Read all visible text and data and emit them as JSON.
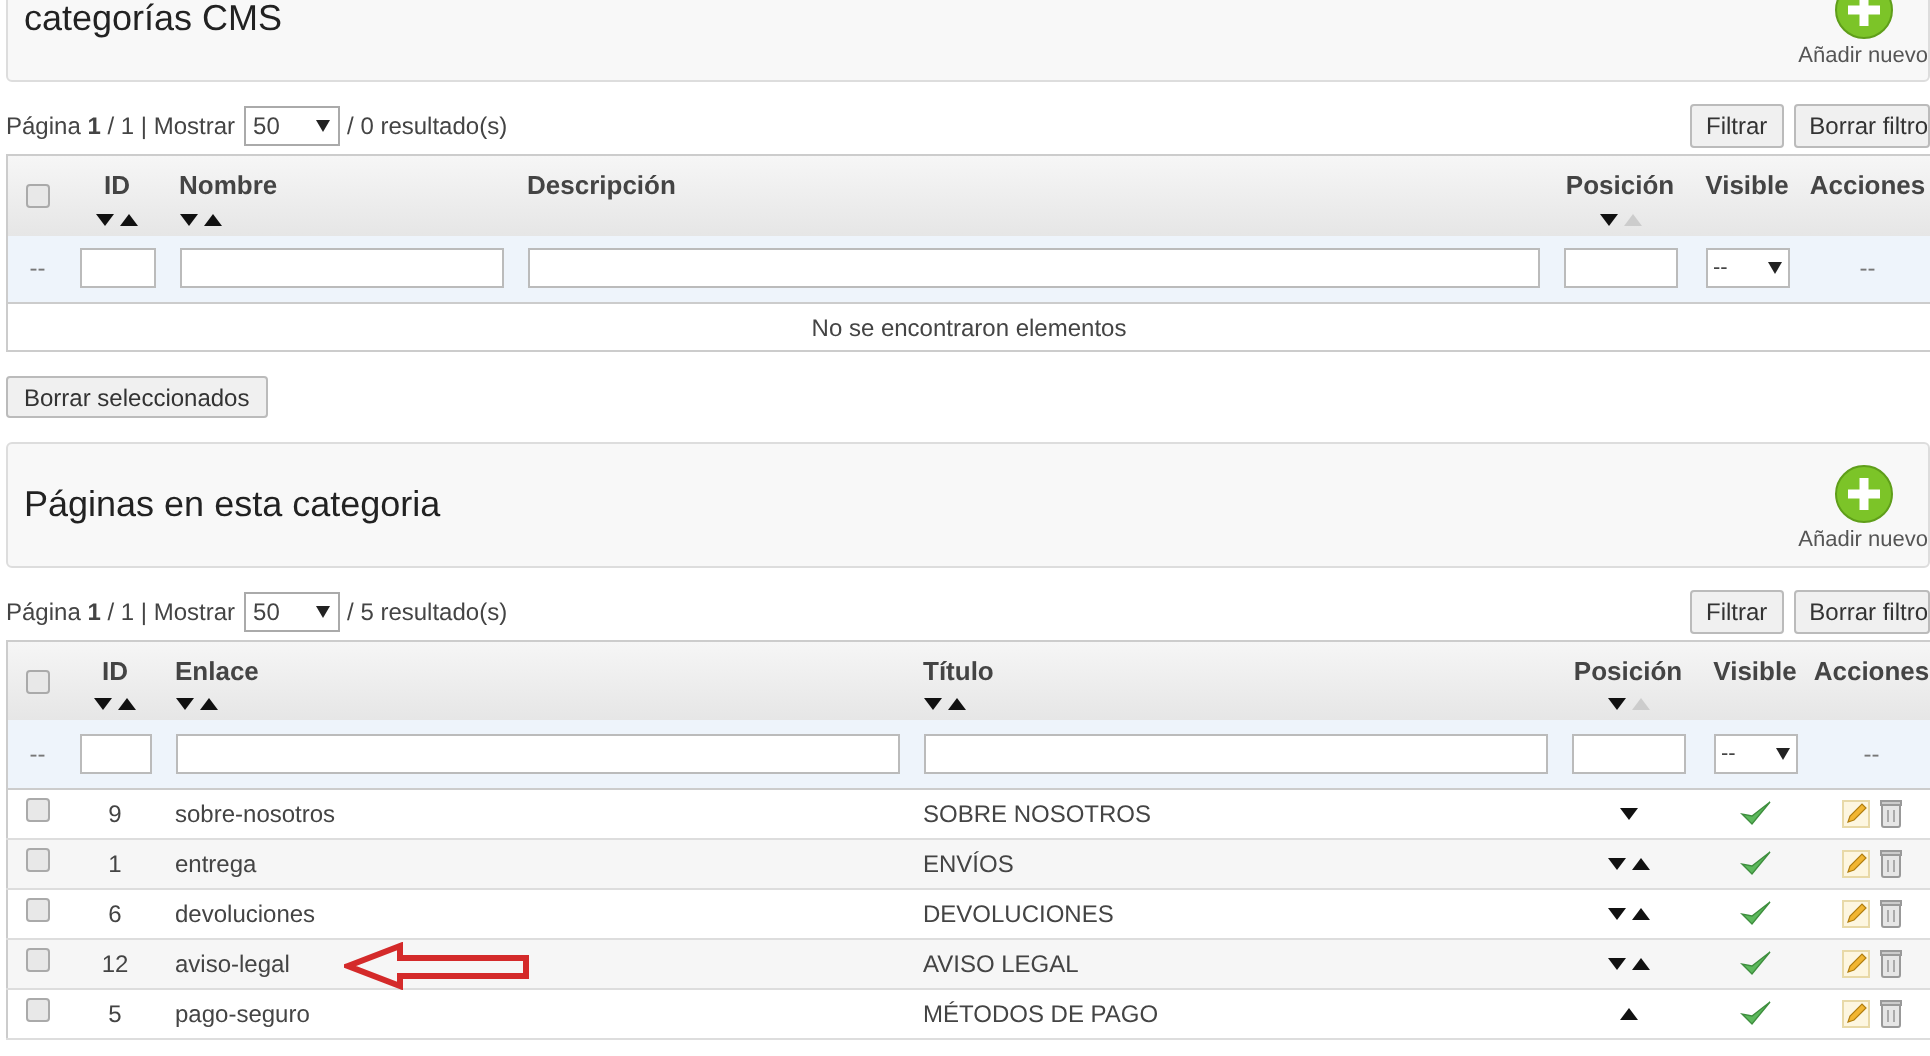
{
  "sections": [
    {
      "title": "categorías CMS",
      "add_label": "Añadir nuevo",
      "pagination": {
        "text": "Página **1** / 1 | Mostrar",
        "per_page": "50",
        "results": "/ 0 resultado(s)"
      },
      "filter_button": "Filtrar",
      "reset_button": "Borrar filtro",
      "columns": [
        {
          "kind": "checkbox",
          "checked": false,
          "filter_text": "--"
        },
        {
          "kind": "id",
          "label": "ID",
          "sortable": true,
          "up_active": true,
          "filter_field": true
        },
        {
          "kind": "text",
          "label": "Nombre",
          "sortable": true,
          "up_active": true,
          "filter_field": true
        },
        {
          "kind": "text",
          "label": "Descripción",
          "sortable": false,
          "filter_field": true
        },
        {
          "kind": "position",
          "label": "Posición",
          "sortable": true,
          "up_active": false,
          "filter_field": true
        },
        {
          "kind": "visible",
          "label": "Visible",
          "sortable": false,
          "filter_select": "--"
        },
        {
          "kind": "actions",
          "label": "Acciones",
          "sortable": false,
          "filter_text": "--"
        }
      ],
      "empty_message": "No se encontraron elementos",
      "bulk_button": "Borrar seleccionados"
    },
    {
      "title": "Páginas en esta categoria",
      "add_label": "Añadir nuevo",
      "pagination": {
        "text": "Página **1** / 1 | Mostrar",
        "per_page": "50",
        "results": "/ 5 resultado(s)"
      },
      "filter_button": "Filtrar",
      "reset_button": "Borrar filtro",
      "columns": [
        {
          "kind": "checkbox",
          "checked": false,
          "filter_text": "--"
        },
        {
          "kind": "id",
          "label": "ID",
          "sortable": true,
          "up_active": true,
          "filter_field": true
        },
        {
          "kind": "text",
          "label": "Enlace",
          "sortable": true,
          "up_active": true,
          "filter_field": true
        },
        {
          "kind": "text",
          "label": "Título",
          "sortable": true,
          "up_active": true,
          "filter_field": true
        },
        {
          "kind": "position",
          "label": "Posición",
          "sortable": true,
          "up_active": false,
          "filter_field": true
        },
        {
          "kind": "visible",
          "label": "Visible",
          "sortable": false,
          "filter_select": "--"
        },
        {
          "kind": "actions",
          "label": "Acciones",
          "sortable": false,
          "filter_text": "--"
        }
      ],
      "rows": [
        {
          "checked": false,
          "id": "9",
          "texts": [
            "sobre-nosotros",
            "SOBRE NOSOTROS"
          ],
          "can_move_down": true,
          "can_move_up": false,
          "visible": true,
          "pointed": false
        },
        {
          "checked": false,
          "id": "1",
          "texts": [
            "entrega",
            "ENVÍOS"
          ],
          "can_move_down": true,
          "can_move_up": true,
          "visible": true,
          "pointed": false
        },
        {
          "checked": false,
          "id": "6",
          "texts": [
            "devoluciones",
            "DEVOLUCIONES"
          ],
          "can_move_down": true,
          "can_move_up": true,
          "visible": true,
          "pointed": false
        },
        {
          "checked": false,
          "id": "12",
          "texts": [
            "aviso-legal",
            "AVISO LEGAL"
          ],
          "can_move_down": true,
          "can_move_up": true,
          "visible": true,
          "pointed": true
        },
        {
          "checked": false,
          "id": "5",
          "texts": [
            "pago-seguro",
            "MÉTODOS DE PAGO"
          ],
          "can_move_down": false,
          "can_move_up": true,
          "visible": true,
          "pointed": false
        }
      ]
    }
  ]
}
